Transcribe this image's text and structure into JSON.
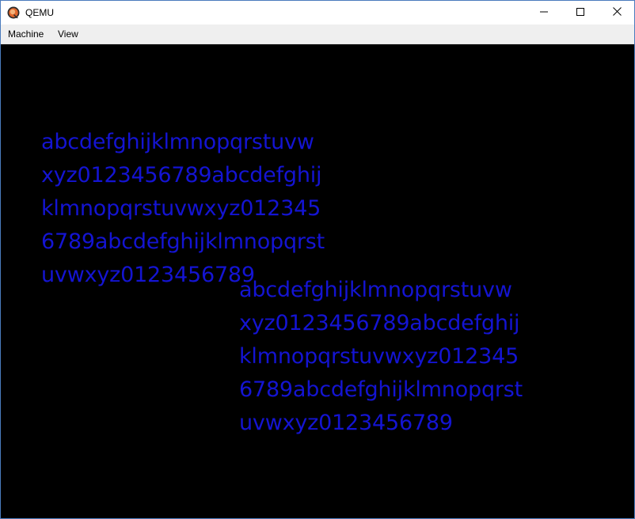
{
  "window": {
    "title": "QEMU",
    "app_icon": "qemu-logo-icon",
    "controls": {
      "minimize_icon": "minimize-icon",
      "maximize_icon": "maximize-icon",
      "close_icon": "close-icon"
    }
  },
  "menubar": {
    "items": [
      {
        "label": "Machine"
      },
      {
        "label": "View"
      }
    ]
  },
  "screen": {
    "background": "#000000",
    "text_color": "#1414d2",
    "blocks": [
      {
        "lines": [
          "abcdefghijklmnopqrstuvw",
          "xyz0123456789abcdefghij",
          "klmnopqrstuvwxyz012345",
          "6789abcdefghijklmnopqrst",
          "uvwxyz0123456789"
        ]
      },
      {
        "lines": [
          "abcdefghijklmnopqrstuvw",
          "xyz0123456789abcdefghij",
          "klmnopqrstuvwxyz012345",
          "6789abcdefghijklmnopqrst",
          "uvwxyz0123456789"
        ]
      }
    ]
  }
}
